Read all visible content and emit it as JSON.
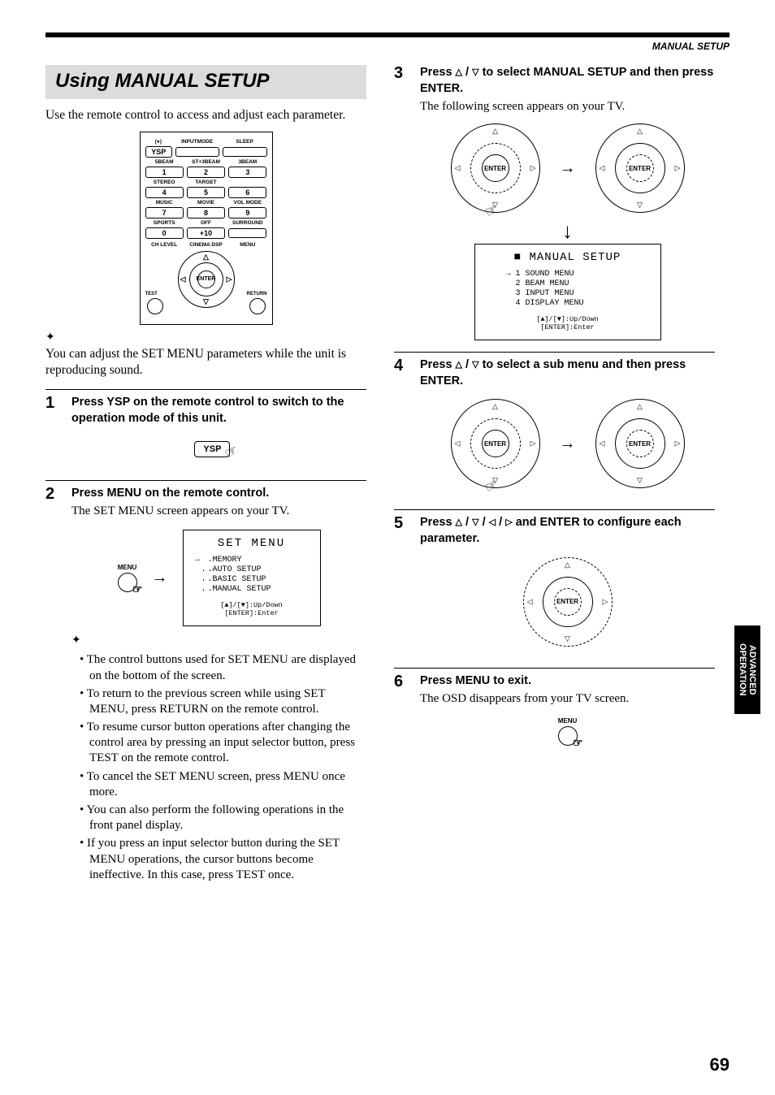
{
  "header": {
    "section_label": "MANUAL SETUP"
  },
  "title": "Using MANUAL SETUP",
  "intro": "Use the remote control to access and adjust each parameter.",
  "remote": {
    "row1_labels": [
      "",
      "INPUTMODE",
      "SLEEP"
    ],
    "dot_label": "●",
    "ysp": "YSP",
    "row2_labels": [
      "5BEAM",
      "ST+3BEAM",
      "3BEAM"
    ],
    "row2_nums": [
      "1",
      "2",
      "3"
    ],
    "row3_labels": [
      "STEREO",
      "TARGET",
      ""
    ],
    "row3_nums": [
      "4",
      "5",
      "6"
    ],
    "row4_labels": [
      "MUSIC",
      "MOVIE",
      "VOL MODE"
    ],
    "row4_nums": [
      "7",
      "8",
      "9"
    ],
    "row5_labels": [
      "SPORTS",
      "OFF",
      "SURROUND"
    ],
    "row5_nums": [
      "0",
      "+10",
      ""
    ],
    "bottom_labels": [
      "CH LEVEL",
      "CINEMA DSP",
      "MENU"
    ],
    "enter": "ENTER",
    "test": "TEST",
    "return": "RETURN"
  },
  "tip1": "You can adjust the SET MENU parameters while the unit is reproducing sound.",
  "steps": {
    "s1": {
      "num": "1",
      "head": "Press YSP on the remote control to switch to the operation mode of this unit.",
      "ysp_label": "YSP"
    },
    "s2": {
      "num": "2",
      "head": "Press MENU on the remote control.",
      "sub": "The SET MENU screen appears on your TV.",
      "menu_label": "MENU",
      "screen": {
        "title": "SET MENU",
        "items": [
          ".MEMORY",
          ".AUTO SETUP",
          ".BASIC SETUP",
          ".MANUAL SETUP"
        ],
        "hint1": "[▲]/[▼]:Up/Down",
        "hint2": "[ENTER]:Enter"
      },
      "bullets": [
        "The control buttons used for SET MENU are displayed on the bottom of the screen.",
        "To return to the previous screen while using SET MENU, press RETURN on the remote control.",
        "To resume cursor button operations after changing the control area by pressing an input selector button, press TEST on the remote control.",
        "To cancel the SET MENU screen, press MENU once more.",
        "You can also perform the following operations in the front panel display.",
        "If you press an input selector button during the SET MENU operations, the cursor buttons become ineffective. In this case, press TEST once."
      ]
    },
    "s3": {
      "num": "3",
      "head_a": "Press ",
      "head_b": " to select MANUAL SETUP and then press ENTER.",
      "sub": "The following screen appears on your TV.",
      "enter": "ENTER",
      "screen": {
        "title": "MANUAL SETUP",
        "items_prefix": [
          "1",
          "2",
          "3",
          "4"
        ],
        "items": [
          "SOUND MENU",
          "BEAM MENU",
          "INPUT MENU",
          "DISPLAY MENU"
        ],
        "hint1": "[▲]/[▼]:Up/Down",
        "hint2": "[ENTER]:Enter"
      }
    },
    "s4": {
      "num": "4",
      "head_a": "Press ",
      "head_b": " to select a sub menu and then press ENTER.",
      "enter": "ENTER"
    },
    "s5": {
      "num": "5",
      "head_a": "Press ",
      "head_b": " and ENTER to configure each parameter.",
      "enter": "ENTER"
    },
    "s6": {
      "num": "6",
      "head": "Press MENU to exit.",
      "sub": "The OSD disappears from your TV screen.",
      "menu_label": "MENU"
    }
  },
  "side_tab": {
    "line1": "ADVANCED",
    "line2": "OPERATION"
  },
  "page_number": "69",
  "symbols": {
    "up": "△",
    "down": "▽",
    "left": "◁",
    "right": "▷",
    "sep": " / "
  }
}
